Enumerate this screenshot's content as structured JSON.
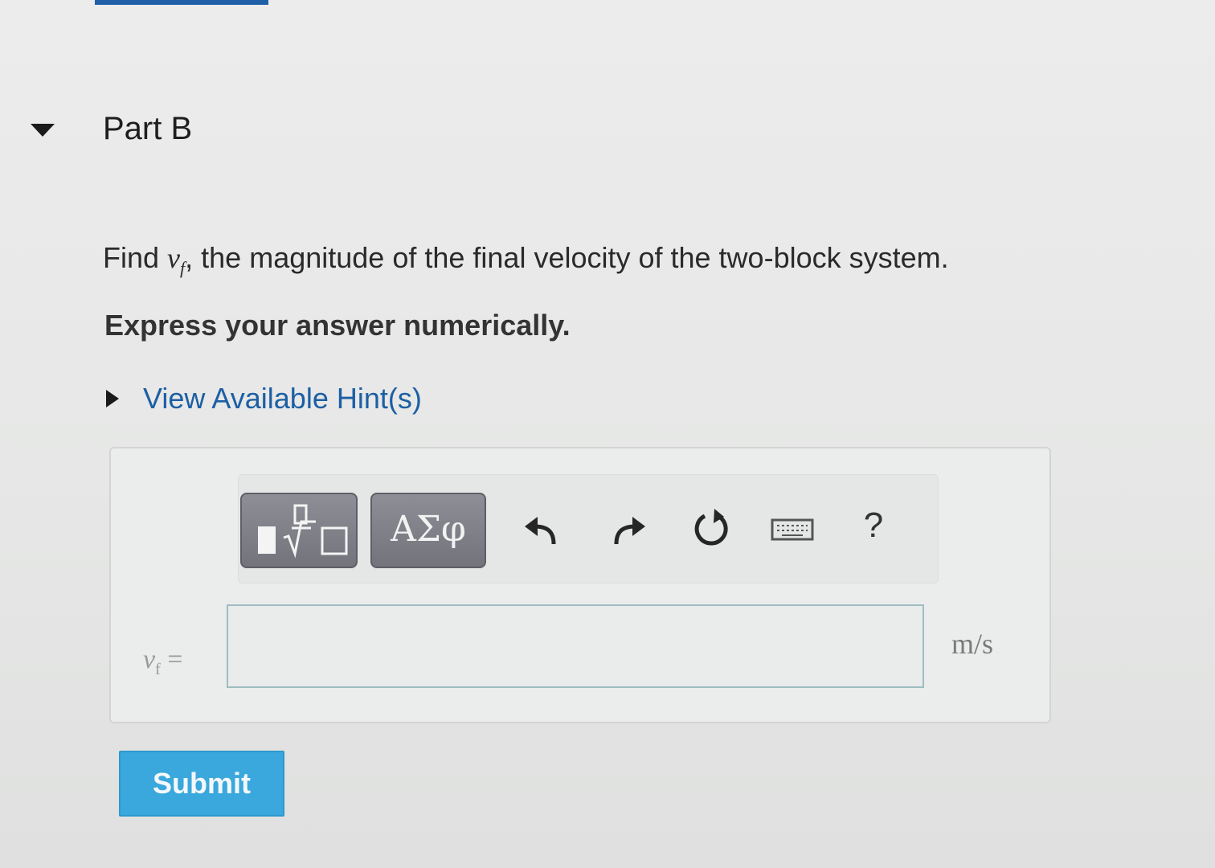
{
  "part": {
    "title": "Part B"
  },
  "question": {
    "prefix": "Find ",
    "variable": "v",
    "variable_subscript": "f",
    "suffix": ", the magnitude of the final velocity of the two-block system."
  },
  "instruction": "Express your answer numerically.",
  "hints": {
    "label": "View Available Hint(s)"
  },
  "toolbar": {
    "templates_icon": "fraction-sqrt-template-icon",
    "symbols_label": "ΑΣφ",
    "undo_icon": "undo-icon",
    "redo_icon": "redo-icon",
    "reset_icon": "reset-icon",
    "keyboard_icon": "keyboard-icon",
    "help_label": "?"
  },
  "answer": {
    "variable": "v",
    "variable_subscript": "f",
    "equals": "=",
    "value": "",
    "units": "m/s"
  },
  "submit": {
    "label": "Submit"
  },
  "colors": {
    "link": "#1c5fa4",
    "submit": "#3aa8dc",
    "toolbar_button": "#7f7f88",
    "input_border": "#9fbdc1"
  }
}
